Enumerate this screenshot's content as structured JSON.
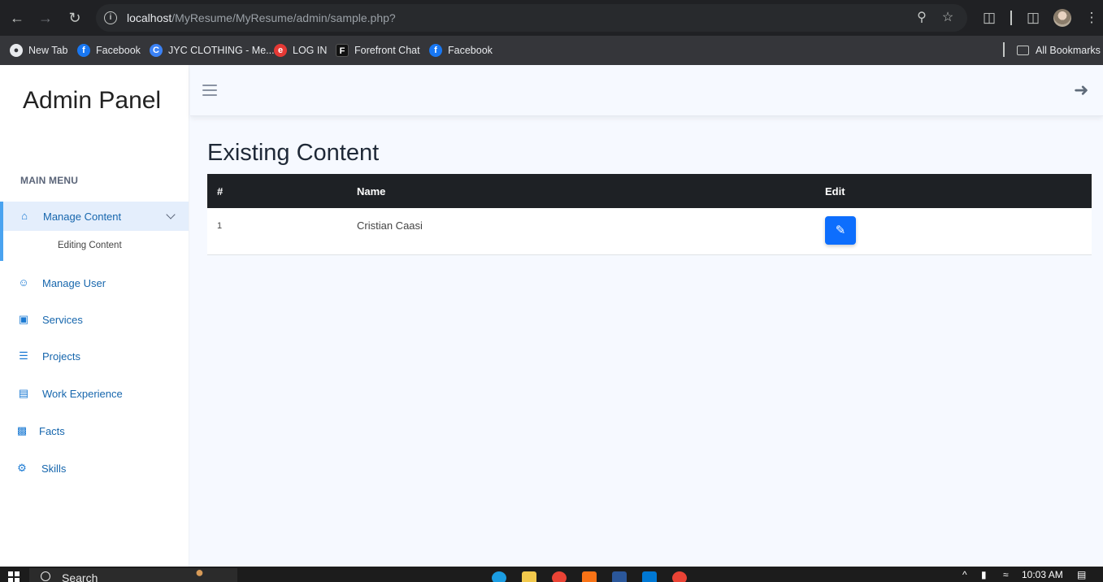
{
  "browser": {
    "url_host": "localhost",
    "url_path": "/MyResume/MyResume/admin/sample.php?",
    "bookmarks": [
      {
        "label": "New Tab",
        "icon": "globe-icon"
      },
      {
        "label": "Facebook",
        "icon": "facebook-icon"
      },
      {
        "label": "JYC CLOTHING - Me...",
        "icon": "jyc-icon"
      },
      {
        "label": "LOG IN",
        "icon": "login-icon"
      },
      {
        "label": "Forefront Chat",
        "icon": "forefront-icon"
      },
      {
        "label": "Facebook",
        "icon": "facebook-icon"
      }
    ],
    "all_bookmarks": "All Bookmarks"
  },
  "sidebar": {
    "brand": "Admin Panel",
    "menu_title": "MAIN MENU",
    "items": [
      {
        "label": "Manage Content",
        "icon": "home-icon",
        "active": true
      },
      {
        "label": "Manage User",
        "icon": "user-icon"
      },
      {
        "label": "Services",
        "icon": "file-plus-icon"
      },
      {
        "label": "Projects",
        "icon": "layers-icon"
      },
      {
        "label": "Work Experience",
        "icon": "briefcase-icon"
      },
      {
        "label": "Facts",
        "icon": "bar-chart-icon"
      },
      {
        "label": "Skills",
        "icon": "gears-icon"
      }
    ],
    "submenu": [
      "Editing Content"
    ]
  },
  "main": {
    "title": "Existing Content",
    "table": {
      "headers": [
        "#",
        "Name",
        "Edit"
      ],
      "rows": [
        {
          "id": "1",
          "name": "Cristian Caasi"
        }
      ]
    }
  },
  "taskbar": {
    "search_label": "Search",
    "time": "10:03 AM"
  },
  "colors": {
    "accent": "#0d6efd",
    "sidebar_link": "#1666ad",
    "table_header": "#1e2125",
    "page_bg": "#f6f9ff"
  }
}
